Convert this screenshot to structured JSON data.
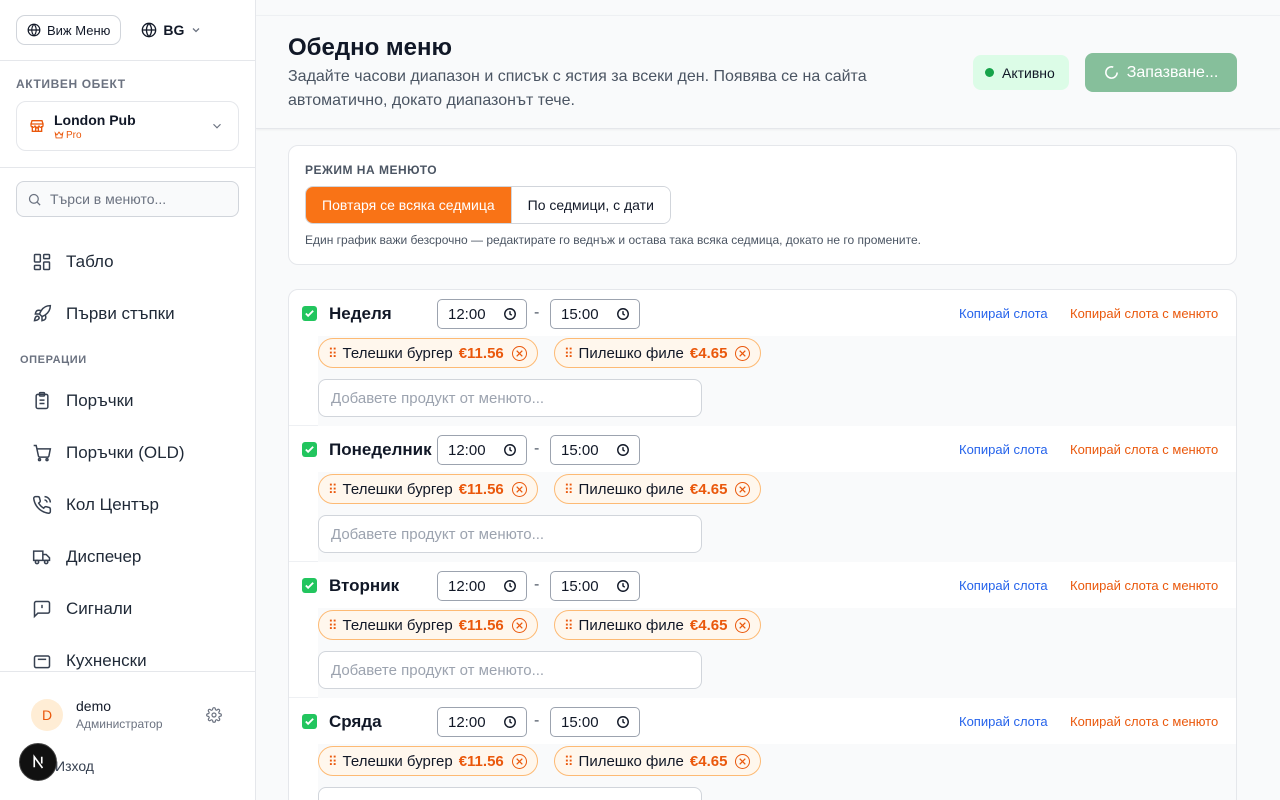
{
  "sidebar": {
    "view_menu_label": "Виж Меню",
    "language": "BG",
    "active_object_label": "АКТИВЕН ОБЕКТ",
    "object_name": "London Pub",
    "object_plan": "Pro",
    "search_placeholder": "Търси в менюто...",
    "nav_top": [
      {
        "label": "Табло",
        "icon": "dashboard-icon"
      },
      {
        "label": "Първи стъпки",
        "icon": "rocket-icon"
      }
    ],
    "section_operations": "ОПЕРАЦИИ",
    "nav_ops": [
      {
        "label": "Поръчки",
        "icon": "clipboard-icon"
      },
      {
        "label": "Поръчки (OLD)",
        "icon": "cart-icon"
      },
      {
        "label": "Кол Център",
        "icon": "phone-icon"
      },
      {
        "label": "Диспечер",
        "icon": "truck-icon"
      },
      {
        "label": "Сигнали",
        "icon": "alert-message-icon"
      },
      {
        "label": "Кухненски",
        "icon": "kitchen-icon"
      }
    ],
    "user": {
      "initial": "D",
      "name": "demo",
      "role": "Администратор"
    },
    "logout_label": "Изход"
  },
  "header": {
    "title": "Обедно меню",
    "subtitle": "Задайте часови диапазон и списък с ястия за всеки ден. Появява се на сайта автоматично, докато диапазонът тече.",
    "status_badge": "Активно",
    "save_label": "Запазване..."
  },
  "mode": {
    "label": "РЕЖИМ НА МЕНЮТО",
    "options": [
      "Повтаря се всяка седмица",
      "По седмици, с дати"
    ],
    "selected": "Повтаря се всяка седмица",
    "note": "Един график важи безсрочно — редактирате го веднъж и остава така всяка седмица, докато не го промените."
  },
  "days": [
    {
      "name": "Неделя",
      "enabled": true,
      "from": "12:00",
      "to": "15:00"
    },
    {
      "name": "Понеделник",
      "enabled": true,
      "from": "12:00",
      "to": "15:00"
    },
    {
      "name": "Вторник",
      "enabled": true,
      "from": "12:00",
      "to": "15:00"
    },
    {
      "name": "Сряда",
      "enabled": true,
      "from": "12:00",
      "to": "15:00"
    }
  ],
  "day_items": [
    {
      "name": "Телешки бургер",
      "price": "€11.56"
    },
    {
      "name": "Пилешко филе",
      "price": "€4.65"
    }
  ],
  "copy_slot_label": "Копирай слота",
  "copy_slot_menu_label": "Копирай слота с менюто",
  "add_product_placeholder": "Добавете продукт от менюто...",
  "time_separator": "-",
  "colors": {
    "accent": "#f97316",
    "active_green": "#16a34a",
    "save_button": "#86bf9b",
    "link_blue": "#2563eb"
  }
}
